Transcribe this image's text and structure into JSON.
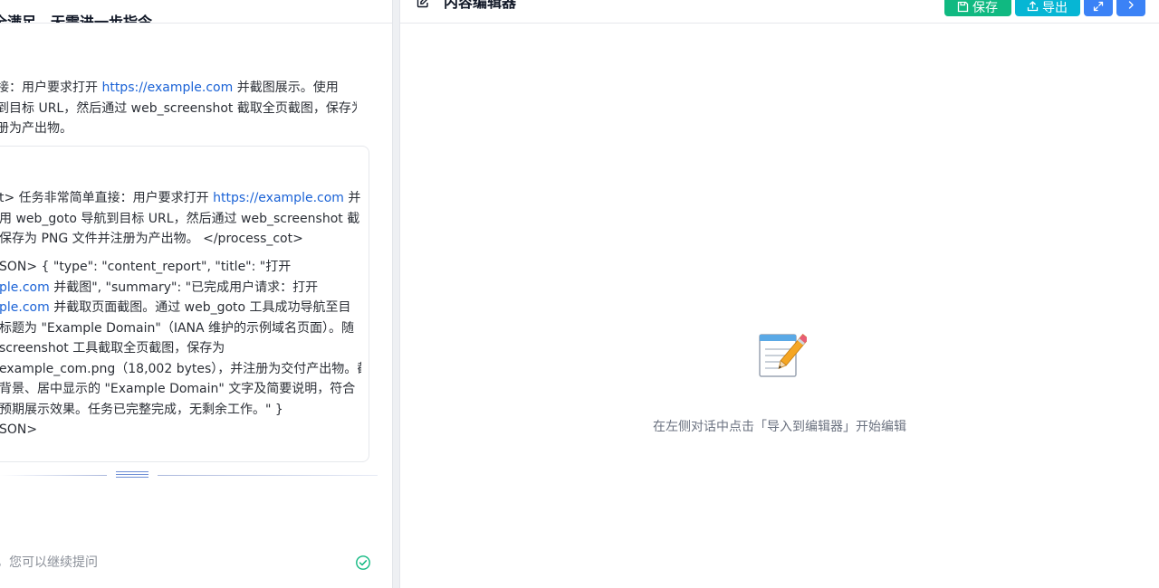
{
  "chat": {
    "heading": "全满足，无需进一步指令。",
    "answer_lines": [
      [
        "接：用户要求打开 ",
        {
          "link": "https://example.com"
        },
        " 并截图展示。使用"
      ],
      [
        "到目标 URL，然后通过 web_screenshot 截取全页截图，保存为"
      ],
      [
        "册为产出物。"
      ]
    ],
    "cot_block": [
      [
        "t> 任务非常简单直接：用户要求打开 ",
        {
          "link": "https://example.com"
        },
        " 并"
      ],
      [
        "用 web_goto 导航到目标 URL，然后通过 web_screenshot 截"
      ],
      [
        "保存为 PNG 文件并注册为产出物。 </process_cot>"
      ]
    ],
    "json_block": [
      [
        "SON> { \"type\": \"content_report\", \"title\": \"打开"
      ],
      [
        {
          "link": "ple.com"
        },
        " 并截图\", \"summary\": \"已完成用户请求：打开"
      ],
      [
        {
          "link": "ple.com"
        },
        " 并截取页面截图。通过 web_goto 工具成功导航至目"
      ],
      [
        "标题为 \"Example Domain\"（IANA 维护的示例域名页面）。随"
      ],
      [
        "screenshot 工具截取全页截图，保存为"
      ],
      [
        "example_com.png（18,002 bytes），并注册为交付产出物。截"
      ],
      [
        "背景、居中显示的 \"Example Domain\" 文字及简要说明，符合"
      ],
      [
        "预期展示效果。任务已完整完成，无剩余工作。\" }"
      ],
      [
        "SON>"
      ]
    ],
    "status_text": "，您可以继续提问"
  },
  "editor": {
    "title": "内容编辑器",
    "save_label": "保存",
    "export_label": "导出",
    "empty_icon": "📝",
    "empty_hint": "在左侧对话中点击「导入到编辑器」开始编辑"
  },
  "colors": {
    "save": "#10b981",
    "export": "#06b6d4",
    "primary": "#3b82f6",
    "link": "#1a62d6",
    "success": "#10b981"
  },
  "icons": {
    "save": "save-icon",
    "export": "export-icon",
    "expand": "expand-icon",
    "next": "chevron-right-icon",
    "status": "check-circle-icon",
    "title": "edit-icon"
  }
}
